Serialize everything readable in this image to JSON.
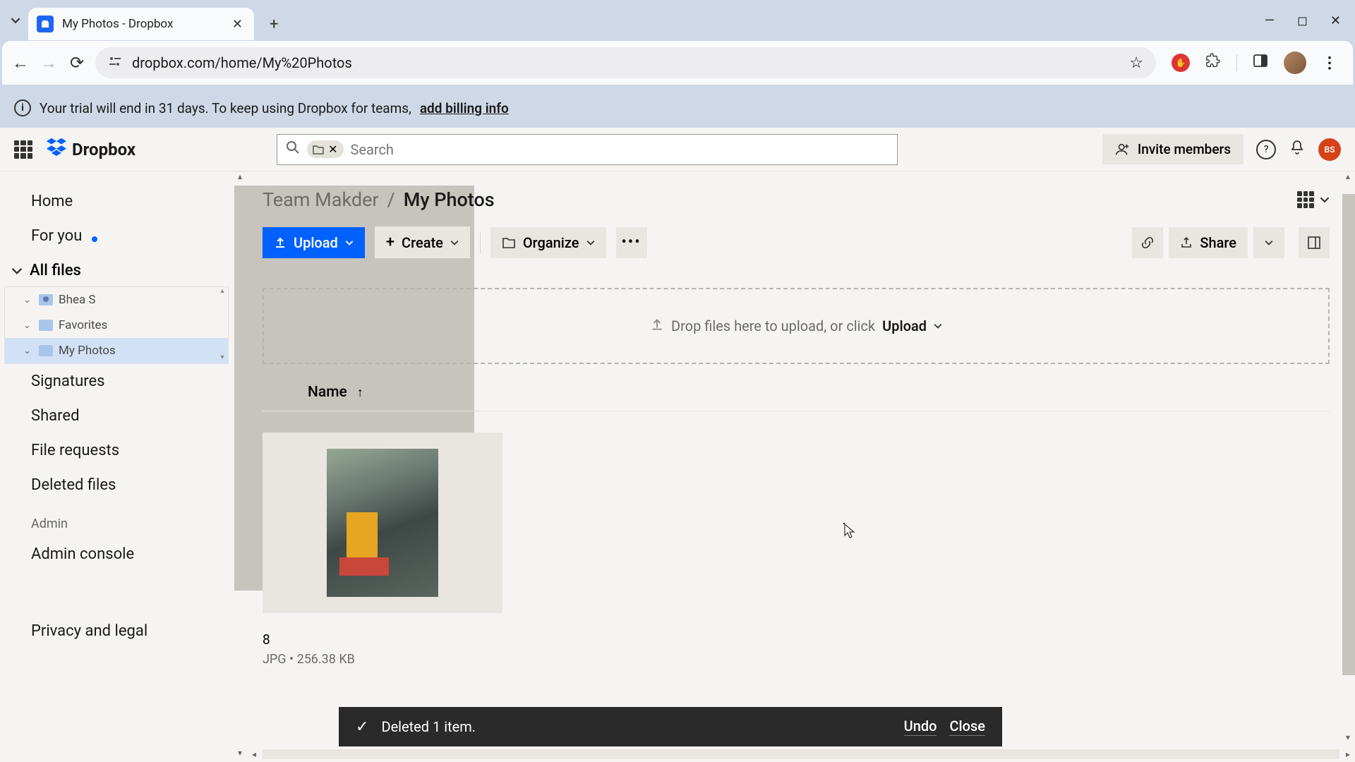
{
  "browser": {
    "tab_title": "My Photos - Dropbox",
    "url": "dropbox.com/home/My%20Photos"
  },
  "trial": {
    "text": "Your trial will end in 31 days. To keep using Dropbox for teams,",
    "link": "add billing info"
  },
  "header": {
    "brand": "Dropbox",
    "search_placeholder": "Search",
    "invite": "Invite members",
    "user_initials": "BS"
  },
  "sidebar": {
    "items": [
      {
        "label": "Home"
      },
      {
        "label": "For you"
      },
      {
        "label": "Signatures"
      },
      {
        "label": "Shared"
      },
      {
        "label": "File requests"
      },
      {
        "label": "Deleted files"
      }
    ],
    "all_files_label": "All files",
    "tree": [
      {
        "label": "Bhea S"
      },
      {
        "label": "Favorites"
      },
      {
        "label": "My Photos"
      }
    ],
    "admin_label": "Admin",
    "admin_console": "Admin console",
    "privacy": "Privacy and legal"
  },
  "breadcrumb": {
    "root": "Team Makder",
    "sep": "/",
    "current": "My Photos"
  },
  "toolbar": {
    "upload": "Upload",
    "create": "Create",
    "organize": "Organize",
    "share": "Share"
  },
  "dropzone": {
    "text": "Drop files here to upload, or click",
    "action": "Upload"
  },
  "table": {
    "name_header": "Name"
  },
  "files": [
    {
      "name": "8",
      "type": "JPG",
      "size": "256.38 KB"
    }
  ],
  "toast": {
    "message": "Deleted 1 item.",
    "undo": "Undo",
    "close": "Close"
  }
}
